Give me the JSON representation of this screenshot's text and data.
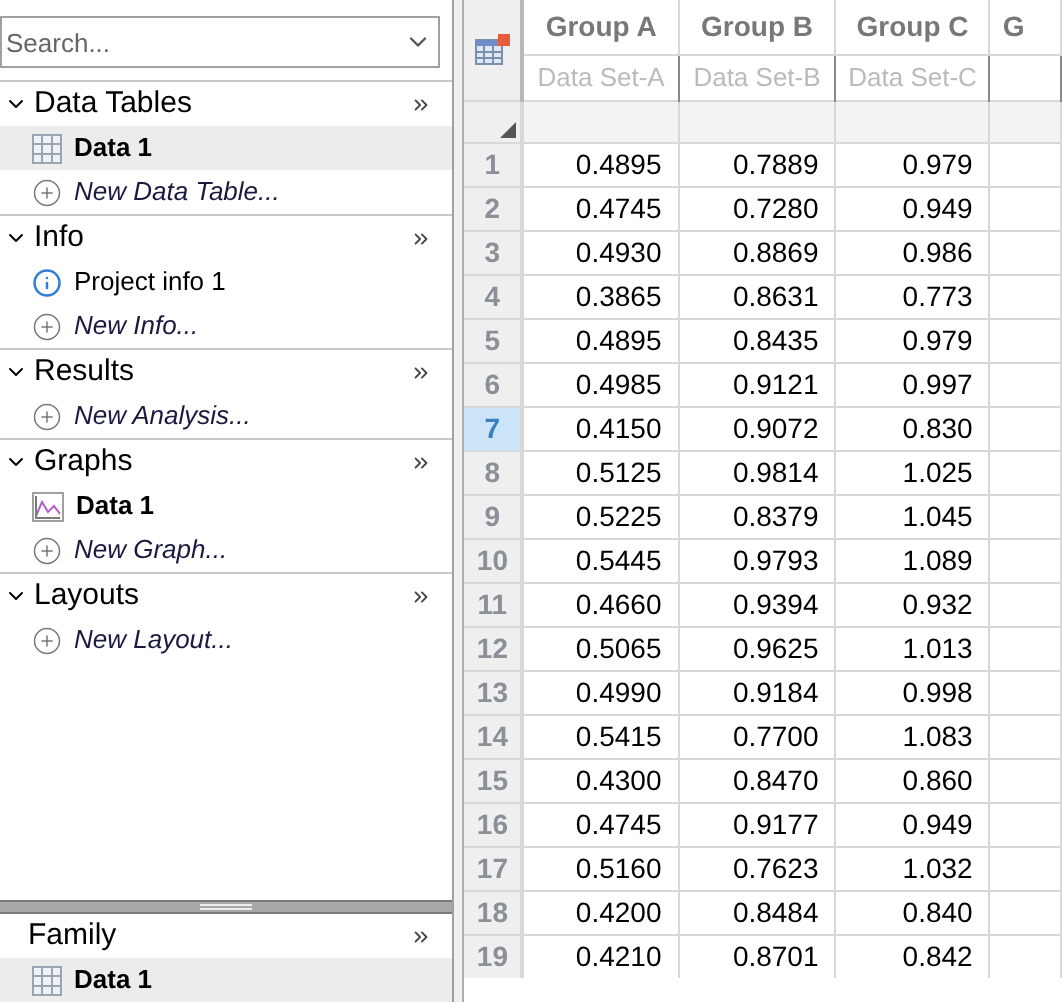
{
  "search": {
    "placeholder": "Search..."
  },
  "sections": [
    {
      "title": "Data Tables",
      "expanded": true,
      "items": [
        {
          "kind": "table",
          "label": "Data 1",
          "selected": true
        },
        {
          "kind": "new",
          "label": "New Data Table...",
          "selected": false
        }
      ]
    },
    {
      "title": "Info",
      "expanded": true,
      "items": [
        {
          "kind": "info",
          "label": "Project info 1",
          "selected": false
        },
        {
          "kind": "new",
          "label": "New Info...",
          "selected": false
        }
      ]
    },
    {
      "title": "Results",
      "expanded": true,
      "items": [
        {
          "kind": "new",
          "label": "New Analysis...",
          "selected": false
        }
      ]
    },
    {
      "title": "Graphs",
      "expanded": true,
      "items": [
        {
          "kind": "graph",
          "label": "Data 1",
          "selected": false
        },
        {
          "kind": "new",
          "label": "New Graph...",
          "selected": false
        }
      ]
    },
    {
      "title": "Layouts",
      "expanded": true,
      "items": [
        {
          "kind": "new",
          "label": "New Layout...",
          "selected": false
        }
      ]
    }
  ],
  "family": {
    "title": "Family",
    "items": [
      {
        "kind": "table",
        "label": "Data 1",
        "selected": true
      }
    ]
  },
  "grid": {
    "columns": [
      {
        "title": "Group A",
        "subtitle": "Data Set-A"
      },
      {
        "title": "Group B",
        "subtitle": "Data Set-B"
      },
      {
        "title": "Group C",
        "subtitle": "Data Set-C"
      },
      {
        "title": "G"
      }
    ],
    "rows": [
      {
        "number": "1",
        "selected": false,
        "values": [
          "0.4895",
          "0.7889",
          "0.979"
        ]
      },
      {
        "number": "2",
        "selected": false,
        "values": [
          "0.4745",
          "0.7280",
          "0.949"
        ]
      },
      {
        "number": "3",
        "selected": false,
        "values": [
          "0.4930",
          "0.8869",
          "0.986"
        ]
      },
      {
        "number": "4",
        "selected": false,
        "values": [
          "0.3865",
          "0.8631",
          "0.773"
        ]
      },
      {
        "number": "5",
        "selected": false,
        "values": [
          "0.4895",
          "0.8435",
          "0.979"
        ]
      },
      {
        "number": "6",
        "selected": false,
        "values": [
          "0.4985",
          "0.9121",
          "0.997"
        ]
      },
      {
        "number": "7",
        "selected": true,
        "values": [
          "0.4150",
          "0.9072",
          "0.830"
        ]
      },
      {
        "number": "8",
        "selected": false,
        "values": [
          "0.5125",
          "0.9814",
          "1.025"
        ]
      },
      {
        "number": "9",
        "selected": false,
        "values": [
          "0.5225",
          "0.8379",
          "1.045"
        ]
      },
      {
        "number": "10",
        "selected": false,
        "values": [
          "0.5445",
          "0.9793",
          "1.089"
        ]
      },
      {
        "number": "11",
        "selected": false,
        "values": [
          "0.4660",
          "0.9394",
          "0.932"
        ]
      },
      {
        "number": "12",
        "selected": false,
        "values": [
          "0.5065",
          "0.9625",
          "1.013"
        ]
      },
      {
        "number": "13",
        "selected": false,
        "values": [
          "0.4990",
          "0.9184",
          "0.998"
        ]
      },
      {
        "number": "14",
        "selected": false,
        "values": [
          "0.5415",
          "0.7700",
          "1.083"
        ]
      },
      {
        "number": "15",
        "selected": false,
        "values": [
          "0.4300",
          "0.8470",
          "0.860"
        ]
      },
      {
        "number": "16",
        "selected": false,
        "values": [
          "0.4745",
          "0.9177",
          "0.949"
        ]
      },
      {
        "number": "17",
        "selected": false,
        "values": [
          "0.5160",
          "0.7623",
          "1.032"
        ]
      },
      {
        "number": "18",
        "selected": false,
        "values": [
          "0.4200",
          "0.8484",
          "0.840"
        ]
      },
      {
        "number": "19",
        "selected": false,
        "values": [
          "0.4210",
          "0.8701",
          "0.842"
        ]
      }
    ]
  }
}
